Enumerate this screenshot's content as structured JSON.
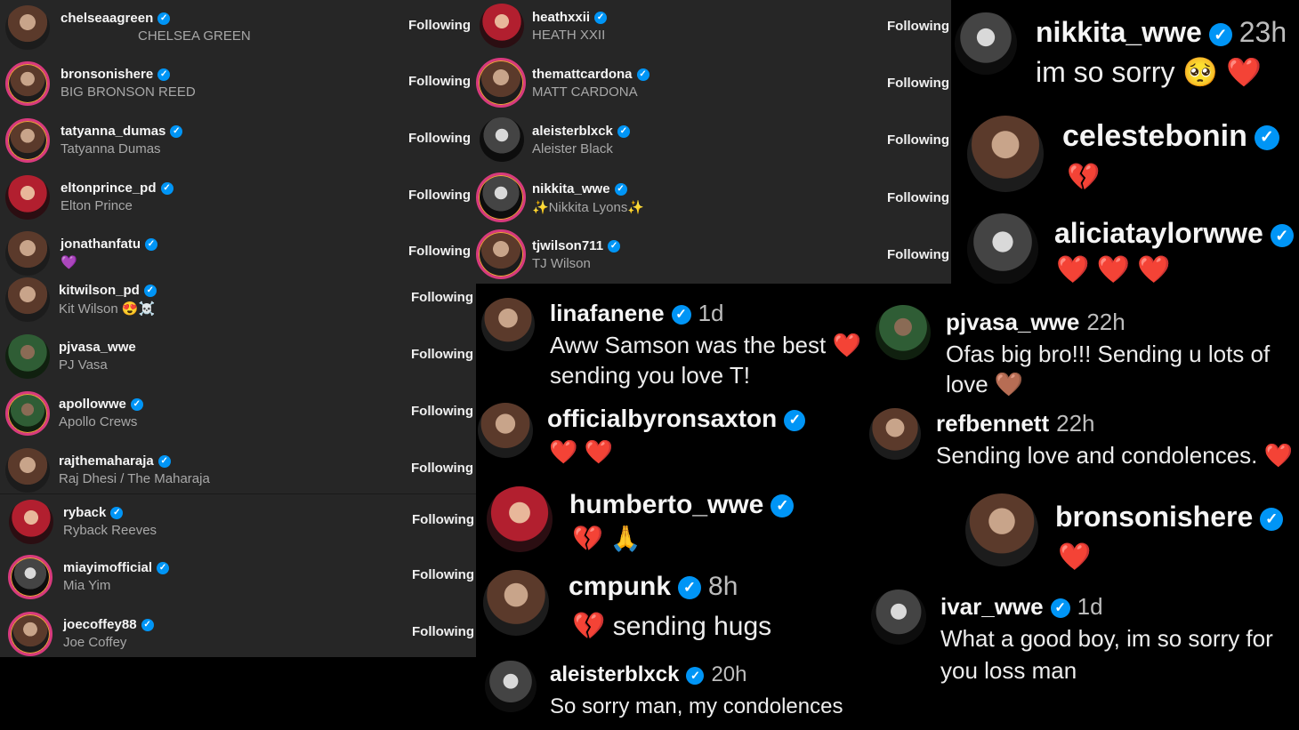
{
  "following": {
    "button_label": "Following",
    "left": [
      {
        "username": "chelseaagreen",
        "name": "CHELSEA GREEN",
        "verified": true
      },
      {
        "username": "bronsonishere",
        "name": "BIG BRONSON REED",
        "verified": true
      },
      {
        "username": "tatyanna_dumas",
        "name": "Tatyanna Dumas",
        "verified": true
      },
      {
        "username": "eltonprince_pd",
        "name": "Elton Prince",
        "verified": true
      },
      {
        "username": "jonathanfatu",
        "name": "💜",
        "verified": true
      },
      {
        "username": "kitwilson_pd",
        "name": "Kit Wilson 😍☠️",
        "verified": true
      },
      {
        "username": "pjvasa_wwe",
        "name": "PJ Vasa",
        "verified": false
      },
      {
        "username": "apollowwe",
        "name": "Apollo Crews",
        "verified": true
      },
      {
        "username": "rajthemaharaja",
        "name": "Raj Dhesi / The Maharaja",
        "verified": true
      },
      {
        "username": "ryback",
        "name": "Ryback Reeves",
        "verified": true
      },
      {
        "username": "miayimofficial",
        "name": "Mia Yim",
        "verified": true
      },
      {
        "username": "joecoffey88",
        "name": "Joe Coffey",
        "verified": true
      }
    ],
    "middle": [
      {
        "username": "heathxxii",
        "name": "HEATH XXII",
        "verified": true
      },
      {
        "username": "themattcardona",
        "name": "MATT CARDONA",
        "verified": true
      },
      {
        "username": "aleisterblxck",
        "name": "Aleister Black",
        "verified": true
      },
      {
        "username": "nikkita_wwe",
        "name": "✨Nikkita Lyons✨",
        "verified": true
      },
      {
        "username": "tjwilson711",
        "name": "TJ Wilson",
        "verified": true
      }
    ]
  },
  "comments": {
    "nikkita": {
      "user": "nikkita_wwe",
      "time": "23h",
      "text": "im so sorry 🥺 ❤️"
    },
    "celeste": {
      "user": "celestebonin",
      "time": "",
      "text": "💔"
    },
    "alicia": {
      "user": "aliciataylorwwe",
      "time": "",
      "text": "❤️ ❤️ ❤️"
    },
    "lina": {
      "user": "linafanene",
      "time": "1d",
      "text1": "Aww Samson was the best ❤️",
      "text2": "sending you love T!"
    },
    "pjvasa": {
      "user": "pjvasa_wwe",
      "time": "22h",
      "text1": "Ofas big bro!!! Sending u lots of",
      "text2": "love 🤎"
    },
    "byron": {
      "user": "officialbyronsaxton",
      "time": "",
      "text": "❤️ ❤️"
    },
    "bennett": {
      "user": "refbennett",
      "time": "22h",
      "text": "Sending love and condolences. ❤️"
    },
    "humberto": {
      "user": "humberto_wwe",
      "time": "",
      "text": "💔 🙏"
    },
    "bronson": {
      "user": "bronsonishere",
      "time": "",
      "text": "❤️"
    },
    "cmpunk": {
      "user": "cmpunk",
      "time": "8h",
      "text": "💔 sending hugs"
    },
    "ivar": {
      "user": "ivar_wwe",
      "time": "1d",
      "text1": "What a good boy, im so sorry for",
      "text2": "you loss man"
    },
    "aleister": {
      "user": "aleisterblxck",
      "time": "20h",
      "text": "So sorry man, my condolences"
    }
  },
  "badge_glyph": "✓",
  "colors": {
    "panel": "#262626",
    "verified": "#0095f6",
    "heart": "#ee2c5a",
    "bg": "#000000"
  }
}
